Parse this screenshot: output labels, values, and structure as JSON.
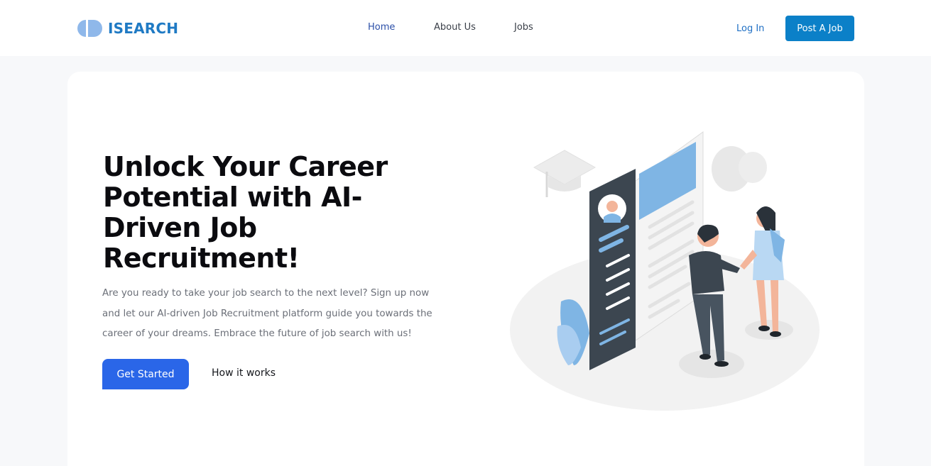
{
  "brand": {
    "name": "ISEARCH",
    "logo_icon": "half-circle-capsule-logo",
    "color": "#1f7ac4"
  },
  "nav": {
    "items": [
      {
        "label": "Home",
        "active": true
      },
      {
        "label": "About Us",
        "active": false
      },
      {
        "label": "Jobs",
        "active": false
      }
    ],
    "login_label": "Log In",
    "post_job_label": "Post A Job"
  },
  "hero": {
    "title": "Unlock Your Career Potential with AI-Driven Job Recruitment!",
    "description": "Are you ready to take your job search to the next level? Sign up now and let our AI-driven Job Recruitment platform guide you towards the career of your dreams. Embrace the future of job search with us!",
    "primary_cta": "Get Started",
    "secondary_cta": "How it works",
    "illustration": "people-shaking-hands-resume-illustration"
  },
  "colors": {
    "accent": "#2a66e8",
    "post_button": "#0b80c8",
    "illustration_blue": "#7fb5e4",
    "illustration_dark": "#3c4650"
  }
}
